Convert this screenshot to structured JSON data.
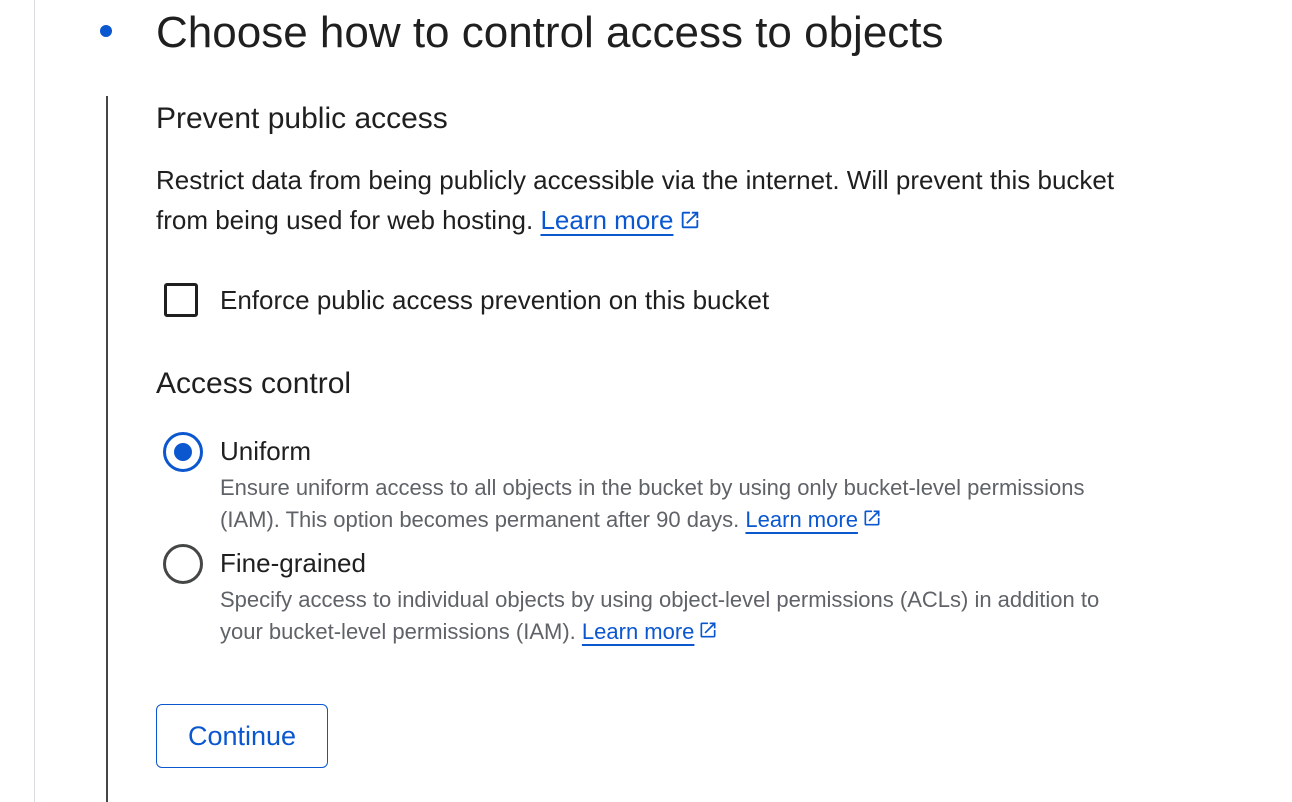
{
  "step": {
    "title": "Choose how to control access to objects"
  },
  "prevent_public_access": {
    "heading": "Prevent public access",
    "description": "Restrict data from being publicly accessible via the internet. Will prevent this bucket from being used for web hosting.",
    "learn_more": "Learn more",
    "checkbox_label": "Enforce public access prevention on this bucket",
    "checkbox_checked": false
  },
  "access_control": {
    "heading": "Access control",
    "options": [
      {
        "label": "Uniform",
        "description": "Ensure uniform access to all objects in the bucket by using only bucket-level permissions (IAM). This option becomes permanent after 90 days.",
        "learn_more": "Learn more",
        "selected": true
      },
      {
        "label": "Fine-grained",
        "description": "Specify access to individual objects by using object-level permissions (ACLs) in addition to your bucket-level permissions (IAM).",
        "learn_more": "Learn more",
        "selected": false
      }
    ]
  },
  "buttons": {
    "continue_label": "Continue"
  },
  "colors": {
    "accent": "#0b57d0",
    "text_primary": "#1f1f1f",
    "text_secondary": "#5f6368"
  },
  "icons": {
    "external_link": "open-in-new-icon",
    "step_marker": "step-dot-icon"
  }
}
